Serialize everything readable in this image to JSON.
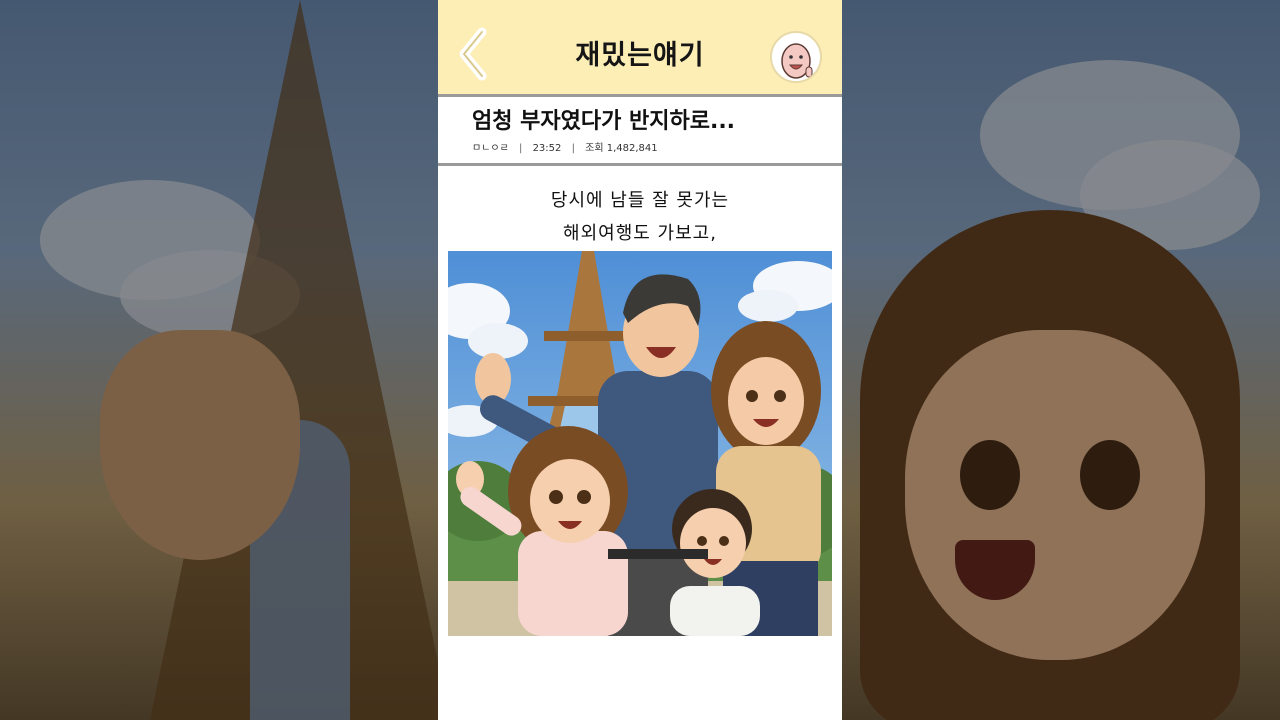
{
  "header": {
    "title": "재밌는얘기",
    "back_icon": "chevron-left-icon",
    "avatar_icon": "cartoon-face-avatar"
  },
  "post": {
    "title": "엄청 부자였다가 반지하로...",
    "author": "ㅁㄴㅇㄹ",
    "time": "23:52",
    "views": "조회 1,482,841",
    "separator": "|"
  },
  "caption": {
    "line1": "당시에 남들 잘 못가는",
    "line2": "해외여행도 가보고,"
  },
  "illustration": {
    "description_icon": "family-at-eiffel-tower-illustration"
  },
  "colors": {
    "header_bg": "#fdeeb6",
    "divider": "#9a9a9a",
    "page_bg": "#ffffff"
  }
}
